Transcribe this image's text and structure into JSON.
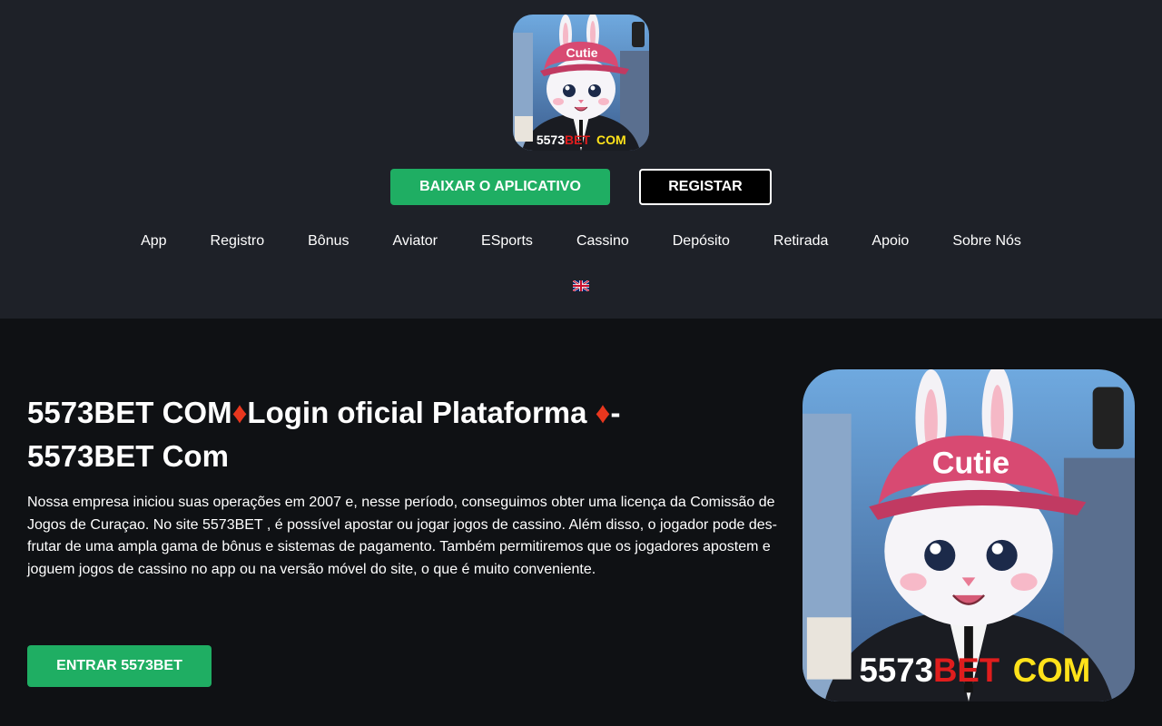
{
  "header": {
    "logo_text_1": "5573",
    "logo_text_2": "BET",
    "logo_text_3": "COM",
    "cap_text": "Cutie",
    "download_label": "BAIXAR O APLICATIVO",
    "register_label": "REGISTAR",
    "language_icon": "uk-flag-icon"
  },
  "nav": {
    "items": [
      {
        "label": "App"
      },
      {
        "label": "Registro"
      },
      {
        "label": "Bônus"
      },
      {
        "label": "Aviator"
      },
      {
        "label": "ESports"
      },
      {
        "label": "Cassino"
      },
      {
        "label": "Depósito"
      },
      {
        "label": "Retirada"
      },
      {
        "label": "Apoio"
      },
      {
        "label": "Sobre Nós"
      }
    ]
  },
  "main": {
    "title_part1": "5573BET COM",
    "title_part2": "Login oficial Plataforma",
    "title_part3": "-",
    "title_part4": "5573BET Com",
    "diamond": "♦",
    "description": "Nossa empresa iniciou suas operações em 2007 e, nesse período, conseguimos obter uma licença da Comissão de Jogos de Curaçao. No site 5573BET , é possível apostar ou jogar jogos de cassino. Além disso, o jogador pode des-frutar de uma ampla gama de bônus e sistemas de pagamento. Também permitiremos que os jogadores apostem e joguem jogos de cassino no app ou na versão móvel do site, o que é muito conveniente.",
    "enter_label": "ENTRAR 5573BET"
  },
  "colors": {
    "header_bg": "#1e2128",
    "page_bg": "#0f1114",
    "accent_green": "#1fae63",
    "diamond_red": "#e8371e"
  }
}
